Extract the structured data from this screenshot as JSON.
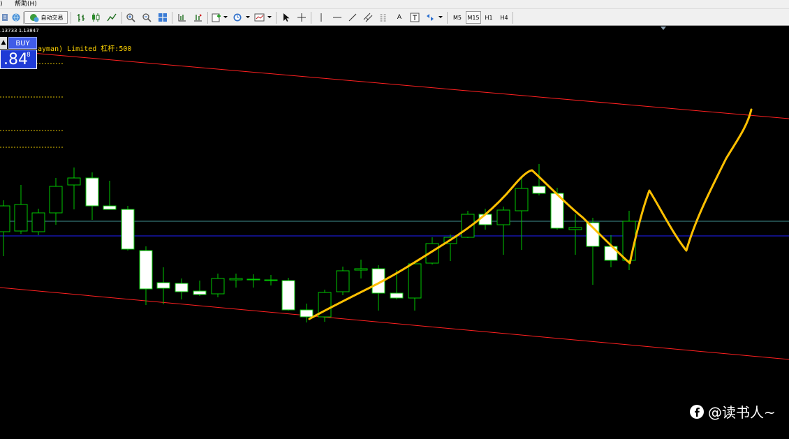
{
  "menu": {
    "left_fragment": ")",
    "help": "帮助(H)"
  },
  "toolbar": {
    "auto_trading_label": "自动交易",
    "period_buttons": [
      "M5",
      "M15",
      "H1",
      "H4"
    ],
    "text_tool_label": "A",
    "icons": [
      "bar-chart-icon",
      "candlestick-icon",
      "line-chart-icon",
      "zoom-in-icon",
      "zoom-out-icon",
      "tile-windows-icon",
      "chart-scroll-icon",
      "chart-shift-icon",
      "indicators-icon",
      "periods-icon",
      "templates-icon",
      "cursor-icon",
      "crosshair-icon",
      "vertical-line-icon",
      "horizontal-line-icon",
      "trendline-icon",
      "fibonacci-icon",
      "channel-icon",
      "text-icon",
      "text-label-icon",
      "arrows-icon"
    ]
  },
  "chart": {
    "price_info": ".13733 1.13847",
    "broker_text": "ayman) Limited 杠杆:500",
    "sell_label": "▲",
    "buy_label": "BUY",
    "buy_price_big": ".84",
    "buy_price_sup": "8"
  },
  "watermark": {
    "text": "@读书人~"
  },
  "colors": {
    "background": "#000000",
    "bull_candle_outline": "#00c800",
    "bear_candle_fill": "#ffffff",
    "wick": "#00c800",
    "channel_lines": "#ff2020",
    "bid_line": "#2020ff",
    "ask_line": "#3f8f8f",
    "annotation": "#ffc000",
    "broker_text": "#ffd400"
  }
}
